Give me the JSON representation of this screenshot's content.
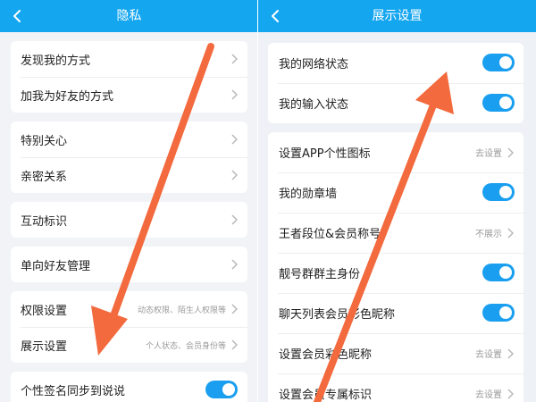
{
  "colors": {
    "header": "#15a6f0",
    "toggle_on": "#1a9ff0",
    "arrow": "#f26a3d"
  },
  "left_screen": {
    "title": "隐私",
    "back_icon": "chevron-left-icon",
    "sections": [
      {
        "items": [
          {
            "label": "发现我的方式"
          },
          {
            "label": "加我为好友的方式"
          }
        ]
      },
      {
        "items": [
          {
            "label": "特别关心"
          },
          {
            "label": "亲密关系"
          }
        ]
      },
      {
        "items": [
          {
            "label": "互动标识"
          }
        ]
      },
      {
        "items": [
          {
            "label": "单向好友管理"
          }
        ]
      },
      {
        "items": [
          {
            "label": "权限设置",
            "sub": "动态权限、陌生人权限等"
          },
          {
            "label": "展示设置",
            "sub": "个人状态、会员身份等"
          }
        ]
      },
      {
        "items": [
          {
            "label": "个性签名同步到说说",
            "toggle": true
          }
        ]
      }
    ]
  },
  "right_screen": {
    "title": "展示设置",
    "back_icon": "chevron-left-icon",
    "sections": [
      {
        "items": [
          {
            "label": "我的网络状态",
            "toggle": true
          },
          {
            "label": "我的输入状态",
            "toggle": true
          }
        ]
      },
      {
        "items": [
          {
            "label": "设置APP个性图标",
            "sub": "去设置"
          },
          {
            "label": "我的勋章墙",
            "toggle": true
          },
          {
            "label": "王者段位&会员称号",
            "sub": "不展示"
          },
          {
            "label": "靓号群群主身份",
            "toggle": true
          },
          {
            "label": "聊天列表会员彩色昵称",
            "toggle": true
          },
          {
            "label": "设置会员彩色昵称",
            "sub": "去设置"
          },
          {
            "label": "设置会员专属标识",
            "sub": "去设置"
          }
        ]
      }
    ]
  }
}
